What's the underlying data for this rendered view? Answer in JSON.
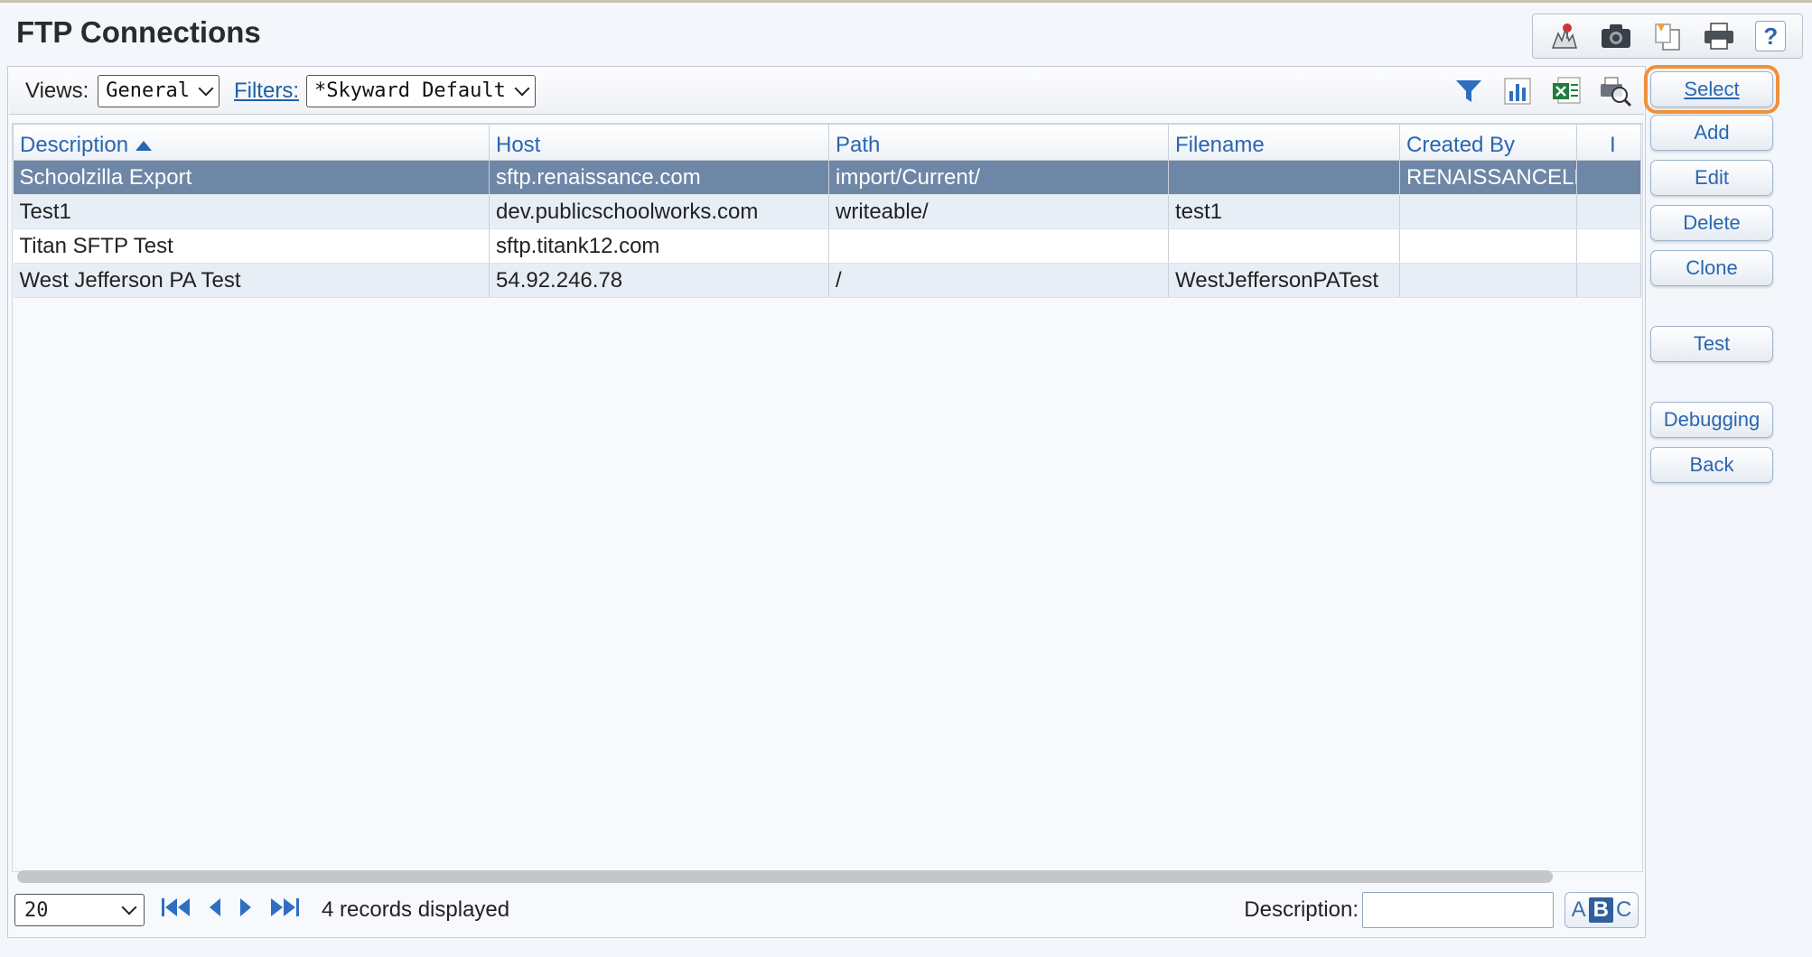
{
  "page": {
    "title": "FTP Connections"
  },
  "top_toolbar": {
    "icons": [
      "report-problem-icon",
      "camera-icon",
      "copy-icon",
      "print-icon",
      "help-icon"
    ],
    "help_label": "?"
  },
  "view_bar": {
    "views_label": "Views:",
    "views_value": "General",
    "filters_label": "Filters:",
    "filters_value": "*Skyward Default",
    "icons": [
      "filter-icon",
      "chart-icon",
      "excel-export-icon",
      "print-preview-icon"
    ]
  },
  "grid": {
    "columns": [
      {
        "label": "Description",
        "sorted": "ascending"
      },
      {
        "label": "Host"
      },
      {
        "label": "Path"
      },
      {
        "label": "Filename"
      },
      {
        "label": "Created By"
      },
      {
        "label": "I"
      }
    ],
    "rows": [
      {
        "description": "Schoolzilla Export",
        "host": "sftp.renaissance.com",
        "path": "import/Current/",
        "filename": "",
        "created_by": "RENAISSANCELEA",
        "selected": true
      },
      {
        "description": "Test1",
        "host": "dev.publicschoolworks.com",
        "path": "writeable/",
        "filename": "test1",
        "created_by": ""
      },
      {
        "description": "Titan SFTP Test",
        "host": "sftp.titank12.com",
        "path": "",
        "filename": "",
        "created_by": ""
      },
      {
        "description": "West Jefferson PA Test",
        "host": "54.92.246.78",
        "path": "/",
        "filename": "WestJeffersonPATest",
        "created_by": ""
      }
    ]
  },
  "footer": {
    "page_size": "20",
    "records_text": "4 records displayed",
    "description_label": "Description:",
    "description_value": "",
    "abc": {
      "a": "A",
      "b": "B",
      "c": "C"
    }
  },
  "side_buttons": {
    "select": "Select",
    "add": "Add",
    "edit": "Edit",
    "delete": "Delete",
    "clone": "Clone",
    "test": "Test",
    "debugging": "Debugging",
    "back": "Back"
  },
  "colors": {
    "selected_row": "#6e87a7",
    "link_blue": "#2a66b0",
    "highlight_orange": "#f0913a"
  }
}
